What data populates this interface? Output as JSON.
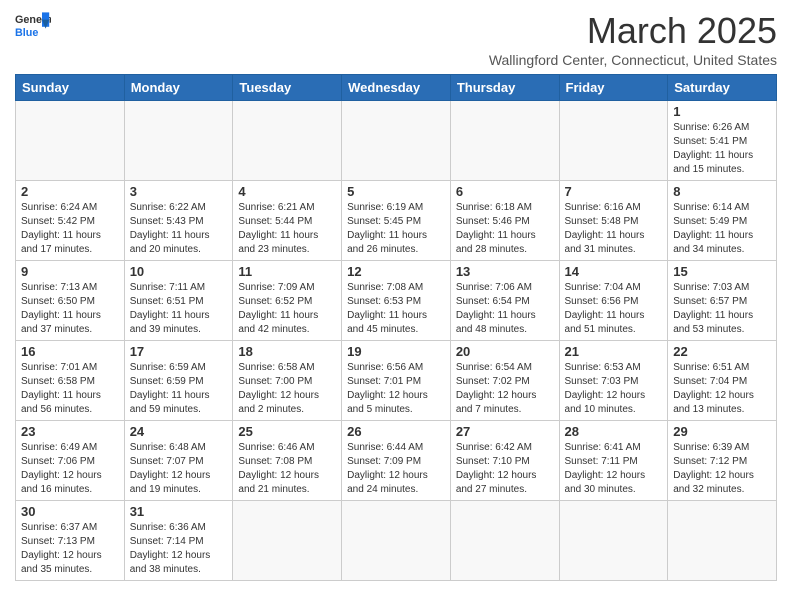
{
  "header": {
    "logo_general": "General",
    "logo_blue": "Blue",
    "month": "March 2025",
    "location": "Wallingford Center, Connecticut, United States"
  },
  "days_of_week": [
    "Sunday",
    "Monday",
    "Tuesday",
    "Wednesday",
    "Thursday",
    "Friday",
    "Saturday"
  ],
  "weeks": [
    [
      {
        "day": "",
        "info": ""
      },
      {
        "day": "",
        "info": ""
      },
      {
        "day": "",
        "info": ""
      },
      {
        "day": "",
        "info": ""
      },
      {
        "day": "",
        "info": ""
      },
      {
        "day": "",
        "info": ""
      },
      {
        "day": "1",
        "info": "Sunrise: 6:26 AM\nSunset: 5:41 PM\nDaylight: 11 hours and 15 minutes."
      }
    ],
    [
      {
        "day": "2",
        "info": "Sunrise: 6:24 AM\nSunset: 5:42 PM\nDaylight: 11 hours and 17 minutes."
      },
      {
        "day": "3",
        "info": "Sunrise: 6:22 AM\nSunset: 5:43 PM\nDaylight: 11 hours and 20 minutes."
      },
      {
        "day": "4",
        "info": "Sunrise: 6:21 AM\nSunset: 5:44 PM\nDaylight: 11 hours and 23 minutes."
      },
      {
        "day": "5",
        "info": "Sunrise: 6:19 AM\nSunset: 5:45 PM\nDaylight: 11 hours and 26 minutes."
      },
      {
        "day": "6",
        "info": "Sunrise: 6:18 AM\nSunset: 5:46 PM\nDaylight: 11 hours and 28 minutes."
      },
      {
        "day": "7",
        "info": "Sunrise: 6:16 AM\nSunset: 5:48 PM\nDaylight: 11 hours and 31 minutes."
      },
      {
        "day": "8",
        "info": "Sunrise: 6:14 AM\nSunset: 5:49 PM\nDaylight: 11 hours and 34 minutes."
      }
    ],
    [
      {
        "day": "9",
        "info": "Sunrise: 7:13 AM\nSunset: 6:50 PM\nDaylight: 11 hours and 37 minutes."
      },
      {
        "day": "10",
        "info": "Sunrise: 7:11 AM\nSunset: 6:51 PM\nDaylight: 11 hours and 39 minutes."
      },
      {
        "day": "11",
        "info": "Sunrise: 7:09 AM\nSunset: 6:52 PM\nDaylight: 11 hours and 42 minutes."
      },
      {
        "day": "12",
        "info": "Sunrise: 7:08 AM\nSunset: 6:53 PM\nDaylight: 11 hours and 45 minutes."
      },
      {
        "day": "13",
        "info": "Sunrise: 7:06 AM\nSunset: 6:54 PM\nDaylight: 11 hours and 48 minutes."
      },
      {
        "day": "14",
        "info": "Sunrise: 7:04 AM\nSunset: 6:56 PM\nDaylight: 11 hours and 51 minutes."
      },
      {
        "day": "15",
        "info": "Sunrise: 7:03 AM\nSunset: 6:57 PM\nDaylight: 11 hours and 53 minutes."
      }
    ],
    [
      {
        "day": "16",
        "info": "Sunrise: 7:01 AM\nSunset: 6:58 PM\nDaylight: 11 hours and 56 minutes."
      },
      {
        "day": "17",
        "info": "Sunrise: 6:59 AM\nSunset: 6:59 PM\nDaylight: 11 hours and 59 minutes."
      },
      {
        "day": "18",
        "info": "Sunrise: 6:58 AM\nSunset: 7:00 PM\nDaylight: 12 hours and 2 minutes."
      },
      {
        "day": "19",
        "info": "Sunrise: 6:56 AM\nSunset: 7:01 PM\nDaylight: 12 hours and 5 minutes."
      },
      {
        "day": "20",
        "info": "Sunrise: 6:54 AM\nSunset: 7:02 PM\nDaylight: 12 hours and 7 minutes."
      },
      {
        "day": "21",
        "info": "Sunrise: 6:53 AM\nSunset: 7:03 PM\nDaylight: 12 hours and 10 minutes."
      },
      {
        "day": "22",
        "info": "Sunrise: 6:51 AM\nSunset: 7:04 PM\nDaylight: 12 hours and 13 minutes."
      }
    ],
    [
      {
        "day": "23",
        "info": "Sunrise: 6:49 AM\nSunset: 7:06 PM\nDaylight: 12 hours and 16 minutes."
      },
      {
        "day": "24",
        "info": "Sunrise: 6:48 AM\nSunset: 7:07 PM\nDaylight: 12 hours and 19 minutes."
      },
      {
        "day": "25",
        "info": "Sunrise: 6:46 AM\nSunset: 7:08 PM\nDaylight: 12 hours and 21 minutes."
      },
      {
        "day": "26",
        "info": "Sunrise: 6:44 AM\nSunset: 7:09 PM\nDaylight: 12 hours and 24 minutes."
      },
      {
        "day": "27",
        "info": "Sunrise: 6:42 AM\nSunset: 7:10 PM\nDaylight: 12 hours and 27 minutes."
      },
      {
        "day": "28",
        "info": "Sunrise: 6:41 AM\nSunset: 7:11 PM\nDaylight: 12 hours and 30 minutes."
      },
      {
        "day": "29",
        "info": "Sunrise: 6:39 AM\nSunset: 7:12 PM\nDaylight: 12 hours and 32 minutes."
      }
    ],
    [
      {
        "day": "30",
        "info": "Sunrise: 6:37 AM\nSunset: 7:13 PM\nDaylight: 12 hours and 35 minutes."
      },
      {
        "day": "31",
        "info": "Sunrise: 6:36 AM\nSunset: 7:14 PM\nDaylight: 12 hours and 38 minutes."
      },
      {
        "day": "",
        "info": ""
      },
      {
        "day": "",
        "info": ""
      },
      {
        "day": "",
        "info": ""
      },
      {
        "day": "",
        "info": ""
      },
      {
        "day": "",
        "info": ""
      }
    ]
  ]
}
